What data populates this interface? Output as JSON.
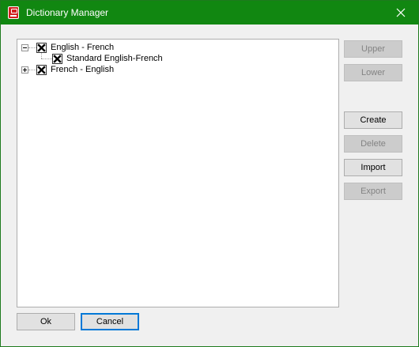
{
  "window": {
    "title": "Dictionary Manager"
  },
  "tree": {
    "nodes": [
      {
        "label": "English - French",
        "expanded": true,
        "children": [
          {
            "label": "Standard English-French"
          }
        ]
      },
      {
        "label": "French - English",
        "expanded": false,
        "children": []
      }
    ]
  },
  "buttons": {
    "upper": "Upper",
    "lower": "Lower",
    "create": "Create",
    "delete": "Delete",
    "import": "Import",
    "export": "Export",
    "ok": "Ok",
    "cancel": "Cancel"
  },
  "colors": {
    "titlebar": "#118711",
    "disabled_text": "#838383"
  }
}
